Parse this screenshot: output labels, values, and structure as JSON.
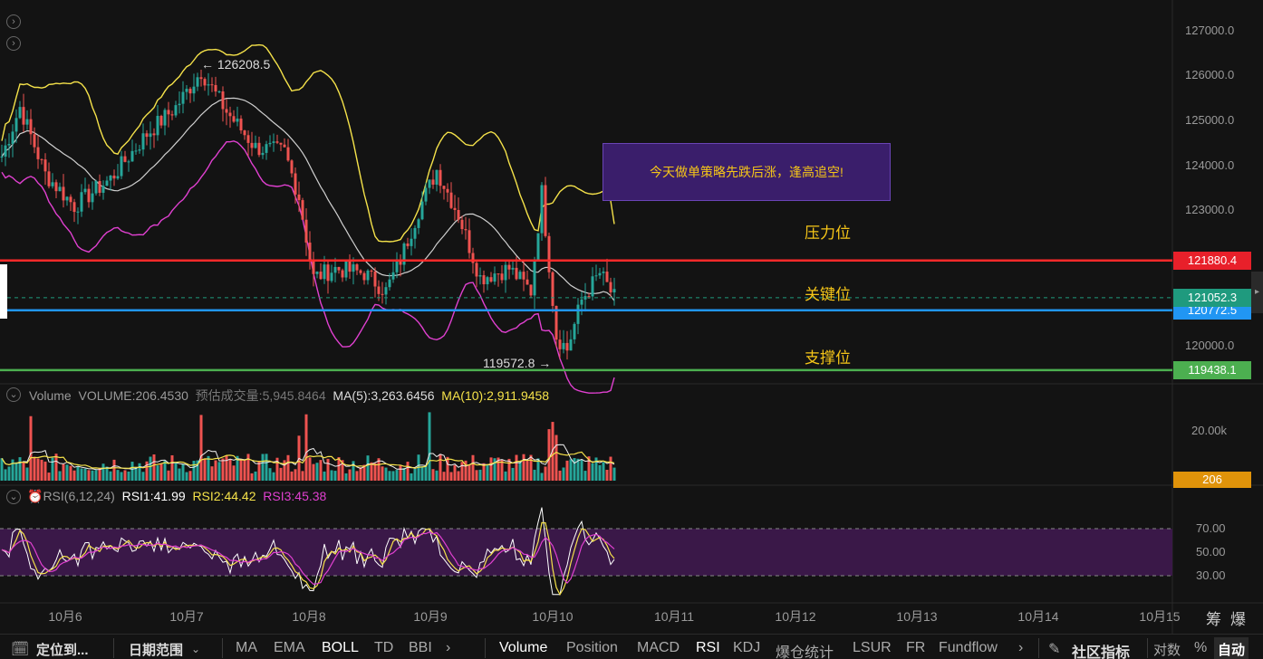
{
  "chart_data": {
    "type": "candlestick",
    "price_axis": {
      "ticks": [
        "127000.0",
        "126000.0",
        "125000.0",
        "124000.0",
        "123000.0",
        "120000.0"
      ],
      "range": [
        119300,
        127300
      ]
    },
    "x_ticks": [
      "10月6",
      "10月7",
      "10月8",
      "10月9",
      "10月10",
      "10月11",
      "10月12",
      "10月13",
      "10月14",
      "10月15"
    ],
    "high_label": "126208.5",
    "low_label": "119572.8",
    "price_tags": {
      "resistance": "121880.4",
      "last": "121052.3",
      "key": "120772.5",
      "support": "119438.1"
    },
    "levels": {
      "resistance": 121880.4,
      "last": 121052.3,
      "key": 120772.5,
      "support": 119438.1
    },
    "volume_axis": {
      "tick": "20.00k",
      "current": "206"
    },
    "rsi_axis": {
      "ticks": [
        "70.00",
        "50.00",
        "30.00"
      ]
    },
    "colors": {
      "up": "#26a69a",
      "down": "#ef5350",
      "boll_upper": "#f5e24a",
      "boll_lower": "#e040d0",
      "boll_mid": "#d0d0d0",
      "resistance": "#ff2a2a",
      "key": "#2196f3",
      "support": "#4caf50",
      "rsi1": "#ffffff",
      "rsi2": "#f5e24a",
      "rsi3": "#e040d0"
    }
  },
  "annotations": {
    "note": "今天做单策略先跌后涨，逢高追空!",
    "resistance": "压力位",
    "key": "关键位",
    "support": "支撑位"
  },
  "volume_pane": {
    "title": "Volume",
    "volume": "VOLUME:206.4530",
    "estimate_label": "预估成交量:",
    "estimate": "5,945.8464",
    "ma5": "MA(5):3,263.6456",
    "ma10": "MA(10):2,911.9458"
  },
  "rsi_pane": {
    "title": "RSI(6,12,24)",
    "rsi1": "RSI1:41.99",
    "rsi2": "RSI2:44.42",
    "rsi3": "RSI3:45.38"
  },
  "top_right": {
    "icons": [
      "筹",
      "爆"
    ]
  },
  "toolbar": {
    "locate": "定位到...",
    "date_range": "日期范围",
    "indicators_main": [
      "MA",
      "EMA",
      "BOLL",
      "TD",
      "BBI"
    ],
    "indicators_sub": [
      "Volume",
      "Position",
      "MACD",
      "RSI",
      "KDJ",
      "爆仓统计",
      "LSUR",
      "FR",
      "Fundflow"
    ],
    "community": "社区指标",
    "log": "对数",
    "percent": "%",
    "auto": "自动"
  }
}
